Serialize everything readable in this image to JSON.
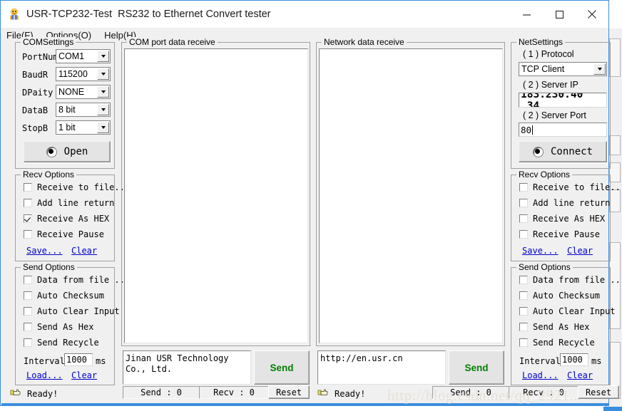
{
  "window": {
    "title": "USR-TCP232-Test  RS232 to Ethernet Convert tester",
    "app_icon": "usr-app-icon",
    "minimize_label": "Minimize",
    "maximize_label": "Maximize",
    "close_label": "Close"
  },
  "menubar": {
    "items": [
      {
        "label": "File(F)",
        "name": "menu-file"
      },
      {
        "label": "Options(O)",
        "name": "menu-options"
      },
      {
        "label": "Help(H)",
        "name": "menu-help"
      }
    ]
  },
  "com_settings": {
    "title": "COMSettings",
    "fields": [
      {
        "label": "PortNum",
        "value": "COM1"
      },
      {
        "label": "BaudR",
        "value": "115200"
      },
      {
        "label": "DPaity",
        "value": "NONE"
      },
      {
        "label": "DataB",
        "value": "8 bit"
      },
      {
        "label": "StopB",
        "value": "1 bit"
      }
    ],
    "open_button": "Open"
  },
  "net_settings": {
    "title": "NetSettings",
    "protocol_label": "( 1 ) Protocol",
    "protocol_value": "TCP Client",
    "server_ip_label": "( 2 ) Server IP",
    "server_ip_value": "183.230.40 .34",
    "server_port_label": "( 2 ) Server Port",
    "server_port_value": "80",
    "connect_button": "Connect"
  },
  "com_recv_options": {
    "title": "Recv Options",
    "checkboxes": [
      {
        "label": "Receive to file...",
        "checked": false
      },
      {
        "label": "Add line return",
        "checked": false
      },
      {
        "label": "Receive As HEX",
        "checked": true
      },
      {
        "label": "Receive Pause",
        "checked": false
      }
    ],
    "save_link": "Save...",
    "clear_link": "Clear"
  },
  "com_send_options": {
    "title": "Send Options",
    "checkboxes": [
      {
        "label": "Data from file ...",
        "checked": false
      },
      {
        "label": "Auto Checksum",
        "checked": false
      },
      {
        "label": "Auto Clear Input",
        "checked": false
      },
      {
        "label": "Send As Hex",
        "checked": false
      },
      {
        "label": "Send Recycle",
        "checked": false
      }
    ],
    "interval_label": "Interval",
    "interval_value": "1000",
    "interval_unit": "ms",
    "load_link": "Load...",
    "clear_link": "Clear"
  },
  "net_recv_options": {
    "title": "Recv Options",
    "checkboxes": [
      {
        "label": "Receive to file...",
        "checked": false
      },
      {
        "label": "Add line return",
        "checked": false
      },
      {
        "label": "Receive As HEX",
        "checked": false
      },
      {
        "label": "Receive Pause",
        "checked": false
      }
    ],
    "save_link": "Save...",
    "clear_link": "Clear"
  },
  "net_send_options": {
    "title": "Send Options",
    "checkboxes": [
      {
        "label": "Data from file ...",
        "checked": false
      },
      {
        "label": "Auto Checksum",
        "checked": false
      },
      {
        "label": "Auto Clear Input",
        "checked": false
      },
      {
        "label": "Send As Hex",
        "checked": false
      },
      {
        "label": "Send Recycle",
        "checked": false
      }
    ],
    "interval_label": "Interval",
    "interval_value": "1000",
    "interval_unit": "ms",
    "load_link": "Load...",
    "clear_link": "Clear"
  },
  "com_pane": {
    "title": "COM port data receive",
    "receive_text": "",
    "send_text": "Jinan USR Technology Co., Ltd.",
    "send_button": "Send",
    "status_ready": "Ready!",
    "send_count": "Send : 0",
    "recv_count": "Recv : 0",
    "reset_button": "Reset"
  },
  "net_pane": {
    "title": "Network data receive",
    "receive_text": "",
    "send_text": "http://en.usr.cn",
    "send_button": "Send",
    "status_ready": "Ready!",
    "send_count": "Send : 0",
    "recv_count": "Recv : 0",
    "reset_button": "Reset"
  },
  "watermark": {
    "text": "http://blog.csdn.net/qq_2921..."
  },
  "colors": {
    "window_border": "#3a8ede",
    "face": "#f0f0f0",
    "link": "#0000cc",
    "send_green": "#008000",
    "watermark": "#e7e1d8"
  }
}
